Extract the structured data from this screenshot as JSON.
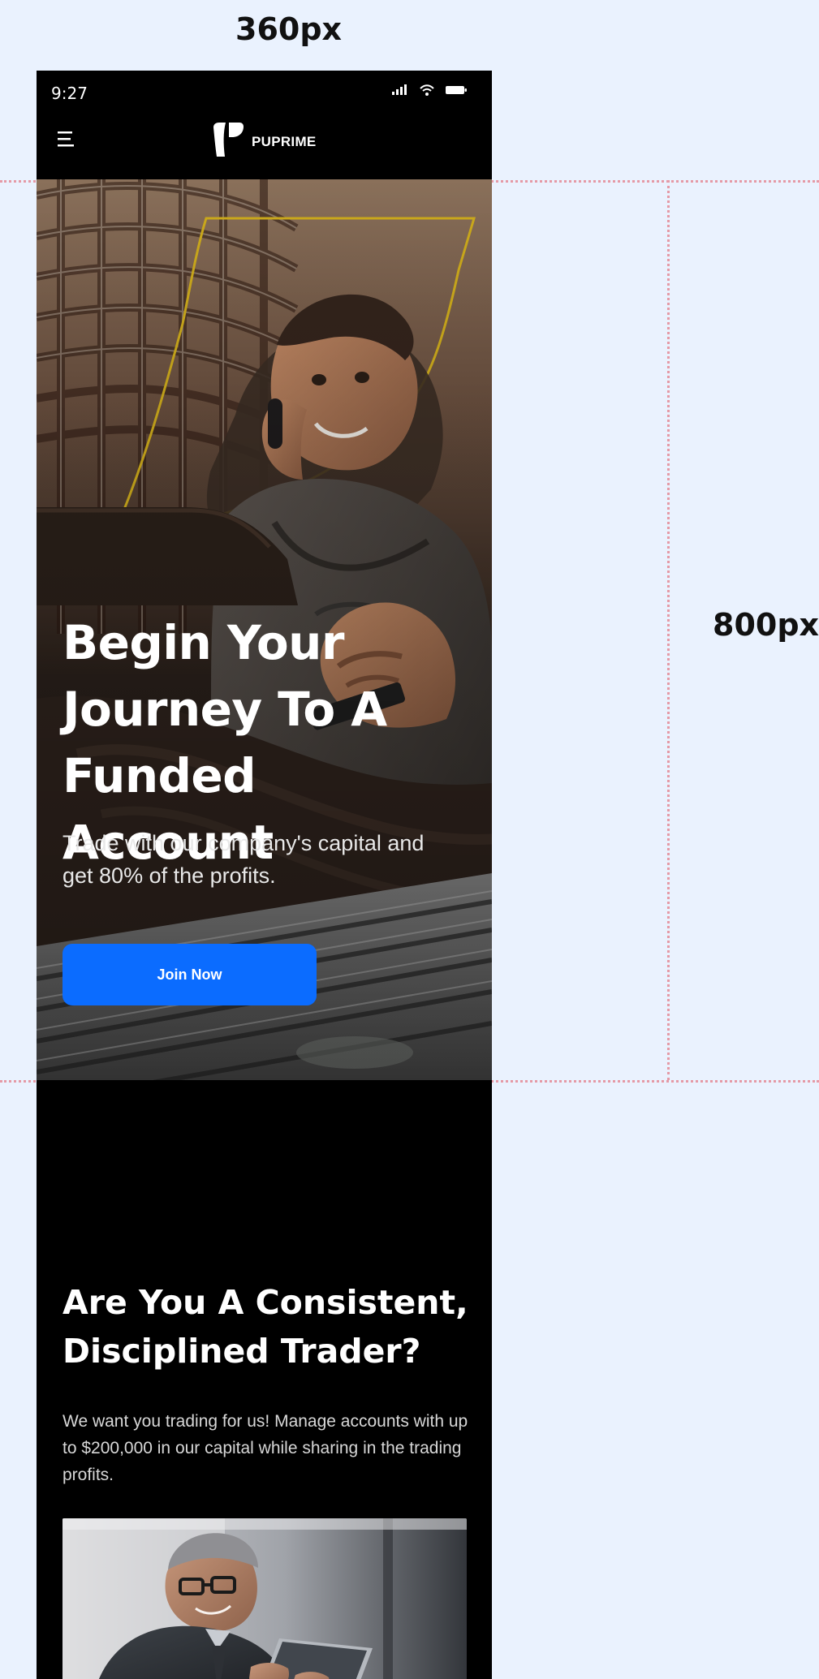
{
  "annotations": {
    "width_label": "360px",
    "height_label": "800px"
  },
  "status_bar": {
    "time": "9:27"
  },
  "nav": {
    "brand": "PUPRIME"
  },
  "hero": {
    "title": "Begin Your Journey To A Funded Account",
    "subtitle": "Trade with our company's capital and get 80% of the profits.",
    "cta_label": "Join Now"
  },
  "section": {
    "title": "Are You A Consistent, Disciplined Trader?",
    "body": "We want you trading for us! Manage accounts with up to $200,000 in our capital while sharing in the trading profits."
  },
  "colors": {
    "page_background": "#eaf2fe",
    "guide": "#e59aa6",
    "cta": "#0b6cff",
    "accent_line": "#d6b21d"
  },
  "icons": {
    "menu": "hamburger-menu-icon",
    "signal": "signal-icon",
    "wifi": "wifi-icon",
    "battery": "battery-icon"
  }
}
